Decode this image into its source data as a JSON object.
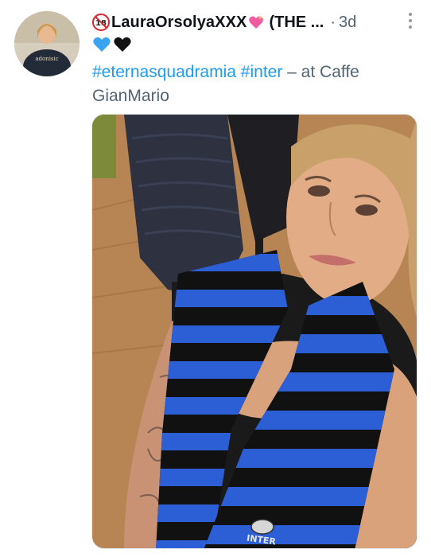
{
  "tweet": {
    "age_badge": "18",
    "display_name": "LauraOrsolyaXXX",
    "name_suffix": "(THE ...",
    "separator": "·",
    "time": "3d",
    "emojis": [
      "blue-heart-icon",
      "black-heart-icon"
    ],
    "text": {
      "hashtag1": "#eternasquadramia",
      "space": " ",
      "hashtag2": "#inter",
      "rest": " – at Caffe GianMario"
    },
    "media_alt": "Selfie photo of a woman wearing a blue and black striped Inter scarf",
    "scarf_logo_text": "INTER",
    "avatar_shirt_text": "adonisic"
  },
  "colors": {
    "link": "#1d9bf0",
    "text": "#0f1419",
    "muted": "#536471",
    "scarf_blue": "#2c5fd6",
    "scarf_black": "#111111"
  }
}
